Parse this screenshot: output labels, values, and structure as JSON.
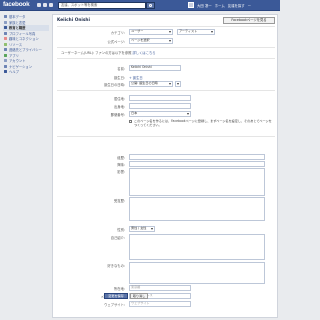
{
  "topbar": {
    "logo": "facebook",
    "search_placeholder": "友達、スポット等を検索",
    "user_name": "大田 凛一",
    "nav_home": "ホーム",
    "nav_find_friends": "友達を探す",
    "nav_menu": "ー"
  },
  "sidebar": {
    "items": [
      {
        "label": "基本データ",
        "icon_color": "#6d84b4"
      },
      {
        "label": "家族と恋愛",
        "icon_color": "#6d84b4"
      },
      {
        "label": "教育と職歴",
        "icon_color": "#6d84b4"
      },
      {
        "label": "プロフィール写真",
        "icon_color": "#6d84b4"
      },
      {
        "label": "趣味とコネクション",
        "icon_color": "#6d84b4"
      },
      {
        "label": "リソース",
        "icon_color": "#6d84b4"
      },
      {
        "label": "連絡先とプライバシー",
        "icon_color": "#6d84b4"
      },
      {
        "label": "アプリ",
        "icon_color": "#6d84b4"
      },
      {
        "label": "アカウント",
        "icon_color": "#6d84b4"
      },
      {
        "label": "ナビゲーション",
        "icon_color": "#6d84b4"
      },
      {
        "label": "ヘルプ",
        "icon_color": "#6d84b4"
      }
    ],
    "active_index": 2
  },
  "main": {
    "title": "Keiichi Onishi",
    "view_profile_label": "Facebookページを見る",
    "category_label": "カテゴリ:",
    "category_value": "ユーザー",
    "subcategory_value": "アーティスト",
    "page_label": "公式ページ:",
    "page_value": "ページを選択",
    "username_note": "ユーザーネーム(URL): ファンの方は以下を参照",
    "username_help": "詳しくはこちら",
    "name_label": "名前:",
    "name_value": "Keiichi Onishi",
    "birthday_label": "誕生日:",
    "birthday_link": "+ 誕生日",
    "birthplace_label": "誕生日の日時:",
    "birthplace_value": "公開: 誕生日の日時",
    "hometown_label": "居住地:",
    "current_label": "出身地:",
    "zip_label": "郵便番号:",
    "zip_value": "日本",
    "info_note": "このページ名を作るには、Facebookページに登録し、まずページ名を設定し、そのあとでページをつくってください。",
    "bio_label": "経歴:",
    "interests_label": "興味:",
    "influences_label": "影響:",
    "awards_label": "受賞歴:",
    "gender_label": "性別:",
    "gender_value": "男性",
    "gender_visibility": "男性 / 女性",
    "personal_info_label": "自己紹介:",
    "likes_label": "好きなもの:",
    "location_label": "所在地:",
    "location_value": "東京都",
    "email_label": "メールアドレス:",
    "email_value": "メールアドレス",
    "website_label": "ウェブサイト:",
    "website_value": "ウェブサイト",
    "save_label": "変更を保存",
    "cancel_label": "取り消し"
  }
}
